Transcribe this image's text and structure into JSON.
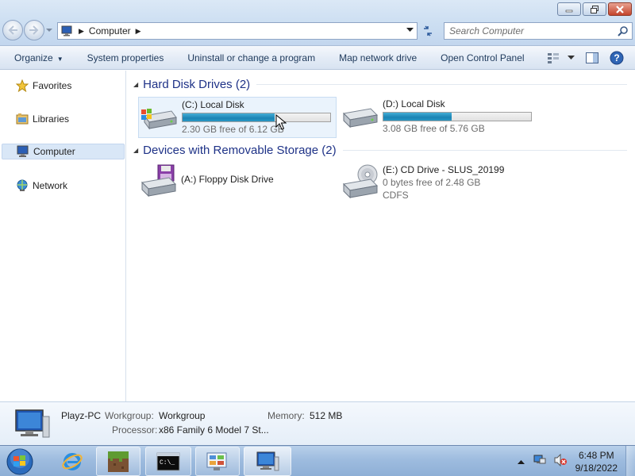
{
  "window": {
    "buttons": {
      "minimize": "minimize",
      "maximize": "maximize",
      "close": "close"
    }
  },
  "address": {
    "location": "Computer",
    "search_placeholder": "Search Computer"
  },
  "toolbar": {
    "organize": "Organize",
    "system_properties": "System properties",
    "uninstall": "Uninstall or change a program",
    "map_network": "Map network drive",
    "open_control_panel": "Open Control Panel"
  },
  "sidebar": {
    "items": [
      {
        "label": "Favorites",
        "icon": "star-icon"
      },
      {
        "label": "Libraries",
        "icon": "libraries-icon"
      },
      {
        "label": "Computer",
        "icon": "computer-icon",
        "selected": true
      },
      {
        "label": "Network",
        "icon": "network-icon"
      }
    ]
  },
  "groups": [
    {
      "title": "Hard Disk Drives (2)",
      "items": [
        {
          "name": "(C:) Local Disk",
          "detail": "2.30 GB free of 6.12 GB",
          "used_fraction": 0.624,
          "selected": true
        },
        {
          "name": "(D:) Local Disk",
          "detail": "3.08 GB free of 5.76 GB",
          "used_fraction": 0.465
        }
      ]
    },
    {
      "title": "Devices with Removable Storage (2)",
      "items": [
        {
          "name": "(A:) Floppy Disk Drive"
        },
        {
          "name": "(E:) CD Drive - SLUS_20199",
          "detail": "0 bytes free of 2.48 GB",
          "filesystem": "CDFS"
        }
      ]
    }
  ],
  "details": {
    "name": "Playz-PC",
    "workgroup_label": "Workgroup:",
    "workgroup_value": "Workgroup",
    "memory_label": "Memory:",
    "memory_value": "512 MB",
    "processor_label": "Processor:",
    "processor_value": "x86 Family 6 Model 7 St..."
  },
  "taskbar": {
    "time": "6:48 PM",
    "date": "9/18/2022"
  },
  "colors": {
    "accent_fill": "#1b83b4",
    "group_title": "#1e3287",
    "link_text": "#1e395b"
  }
}
